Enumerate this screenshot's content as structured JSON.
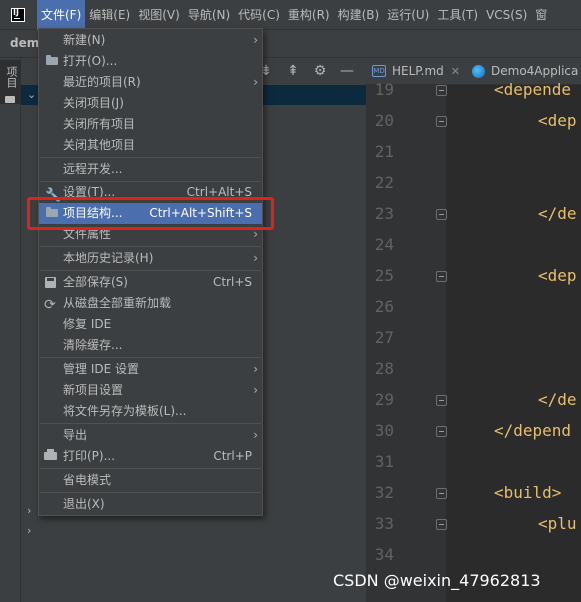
{
  "menubar": {
    "items": [
      "文件(F)",
      "编辑(E)",
      "视图(V)",
      "导航(N)",
      "代码(C)",
      "重构(R)",
      "构建(B)",
      "运行(U)",
      "工具(T)",
      "VCS(S)",
      "窗"
    ],
    "active_index": 0
  },
  "project": {
    "name": "dem"
  },
  "toolstrip": {
    "label": "项目"
  },
  "tabs": [
    {
      "label": "HELP.md",
      "icon": "md-icon"
    },
    {
      "label": "Demo4Applica",
      "icon": "spring-icon"
    }
  ],
  "editor": {
    "line_numbers": [
      "19",
      "20",
      "21",
      "22",
      "23",
      "24",
      "25",
      "26",
      "27",
      "28",
      "29",
      "30",
      "31",
      "32",
      "33",
      "34"
    ],
    "code_lines": [
      "<depende",
      "<dep",
      "",
      "",
      "</de",
      "",
      "<dep",
      "",
      "",
      "",
      "</de",
      "</depend",
      "",
      "<build>",
      "<plu",
      ""
    ]
  },
  "file_menu": {
    "items": [
      {
        "label": "新建(N)",
        "shortcut": "",
        "submenu": true,
        "icon": ""
      },
      {
        "label": "打开(O)...",
        "shortcut": "",
        "submenu": false,
        "icon": "folder-icon"
      },
      {
        "label": "最近的项目(R)",
        "shortcut": "",
        "submenu": true,
        "icon": ""
      },
      {
        "label": "关闭项目(J)",
        "shortcut": "",
        "submenu": false,
        "icon": ""
      },
      {
        "label": "关闭所有项目",
        "shortcut": "",
        "submenu": false,
        "icon": ""
      },
      {
        "label": "关闭其他项目",
        "shortcut": "",
        "submenu": false,
        "icon": ""
      },
      {
        "label": "远程开发...",
        "shortcut": "",
        "submenu": false,
        "icon": ""
      },
      {
        "label": "设置(T)...",
        "shortcut": "Ctrl+Alt+S",
        "submenu": false,
        "icon": "wrench-icon"
      },
      {
        "label": "项目结构...",
        "shortcut": "Ctrl+Alt+Shift+S",
        "submenu": false,
        "icon": "folder-icon",
        "highlighted": true
      },
      {
        "label": "文件属性",
        "shortcut": "",
        "submenu": true,
        "icon": ""
      },
      {
        "label": "本地历史记录(H)",
        "shortcut": "",
        "submenu": true,
        "icon": ""
      },
      {
        "label": "全部保存(S)",
        "shortcut": "Ctrl+S",
        "submenu": false,
        "icon": "save-icon"
      },
      {
        "label": "从磁盘全部重新加载",
        "shortcut": "",
        "submenu": false,
        "icon": "reload-icon"
      },
      {
        "label": "修复 IDE",
        "shortcut": "",
        "submenu": false,
        "icon": ""
      },
      {
        "label": "清除缓存...",
        "shortcut": "",
        "submenu": false,
        "icon": ""
      },
      {
        "label": "管理 IDE 设置",
        "shortcut": "",
        "submenu": true,
        "icon": ""
      },
      {
        "label": "新项目设置",
        "shortcut": "",
        "submenu": true,
        "icon": ""
      },
      {
        "label": "将文件另存为模板(L)...",
        "shortcut": "",
        "submenu": false,
        "icon": ""
      },
      {
        "label": "导出",
        "shortcut": "",
        "submenu": true,
        "icon": ""
      },
      {
        "label": "打印(P)...",
        "shortcut": "Ctrl+P",
        "submenu": false,
        "icon": "print-icon"
      },
      {
        "label": "省电模式",
        "shortcut": "",
        "submenu": false,
        "icon": ""
      },
      {
        "label": "退出(X)",
        "shortcut": "",
        "submenu": false,
        "icon": ""
      }
    ]
  },
  "annotation_color": "#e0231a",
  "highlight_color": "#4b6eaf",
  "watermark": "CSDN @weixin_47962813"
}
